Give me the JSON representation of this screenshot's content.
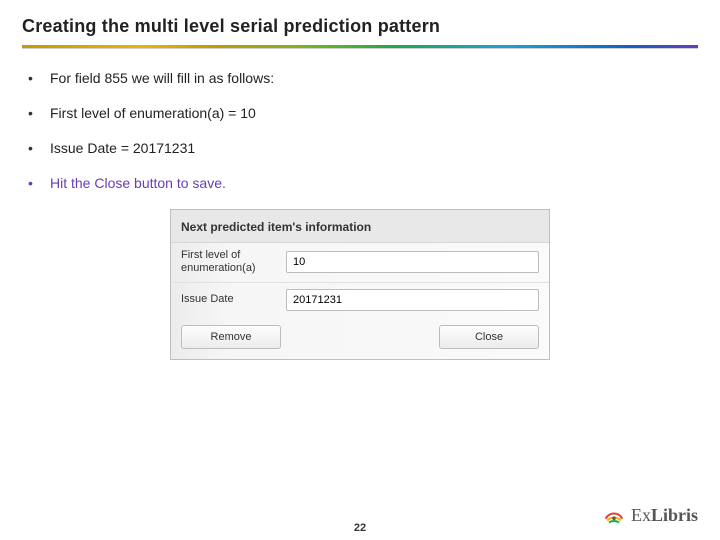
{
  "title": "Creating the multi level serial prediction pattern",
  "bullets": [
    {
      "text": "For field 855 we will fill in as follows:",
      "accent": false
    },
    {
      "text": "First level of enumeration(a) = 10",
      "accent": false
    },
    {
      "text": "Issue Date = 20171231",
      "accent": false
    },
    {
      "text": "Hit the Close button to save.",
      "accent": true
    }
  ],
  "panel": {
    "heading": "Next predicted item's information",
    "row1_label": "First level of enumeration(a)",
    "row1_value": "10",
    "row2_label": "Issue Date",
    "row2_value": "20171231",
    "remove_label": "Remove",
    "close_label": "Close"
  },
  "page_number": "22",
  "logo_text_prefix": "Ex",
  "logo_text_suffix": "Libris"
}
